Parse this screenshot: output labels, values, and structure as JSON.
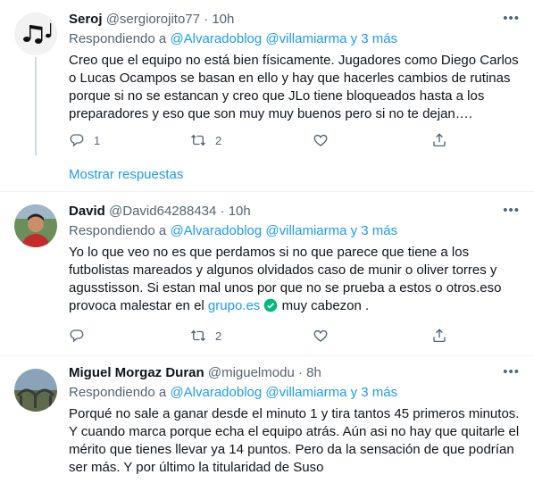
{
  "tweets": [
    {
      "name": "Seroj",
      "handle": "@sergiorojito77",
      "dot": "·",
      "time": "10h",
      "replying_prefix": "Respondiendo a ",
      "replying_to": "@Alvaradoblog @villamiarma y 3 más",
      "text": "Creo que el equipo no está bien físicamente. Jugadores como Diego Carlos o Lucas Ocampos se basan en ello y hay que hacerles cambios de rutinas porque si no se estancan y creo que JLo tiene bloqueados hasta a los preparadores y eso que son muy muy buenos pero si no te dejan….",
      "reply_count": "1",
      "retweet_count": "2",
      "like_count": "",
      "show_replies": "Mostrar respuestas"
    },
    {
      "name": "David",
      "handle": "@David64288434",
      "dot": "·",
      "time": "10h",
      "replying_prefix": "Respondiendo a ",
      "replying_to": "@Alvaradoblog @villamiarma y 3 más",
      "text_before_link": "Yo lo que veo no es que perdamos si no que parece que tiene a los futbolistas mareados y algunos olvidados caso de munir o oliver torres y agusstisson. Si estan mal unos por que no se prueba a estos o otros.eso provoca malestar en el ",
      "link_text": "grupo.es",
      "text_after_link": " muy cabezon .",
      "reply_count": "",
      "retweet_count": "2",
      "like_count": ""
    },
    {
      "name": "Miguel Morgaz Duran",
      "handle": "@miguelmodu",
      "dot": "·",
      "time": "8h",
      "replying_prefix": "Respondiendo a ",
      "replying_to": "@Alvaradoblog @villamiarma y 3 más",
      "text": "Porqué no sale a ganar desde el minuto 1 y tira tantos 45 primeros minutos. Y cuando marca porque echa el equipo atrás. Aún asi no hay que quitarle el mérito que tienes llevar ya 14 puntos. Pero da la sensación de que podrían ser más. Y por último la titularidad de Suso"
    }
  ],
  "icons": {
    "reply": "reply-icon",
    "retweet": "retweet-icon",
    "like": "like-icon",
    "share": "share-icon",
    "more": "more-icon",
    "verified": "verified-check-icon"
  },
  "colors": {
    "link": "#1d9bf0",
    "secondary": "#536471",
    "text": "#0f1419",
    "verified": "#00ba7c"
  }
}
